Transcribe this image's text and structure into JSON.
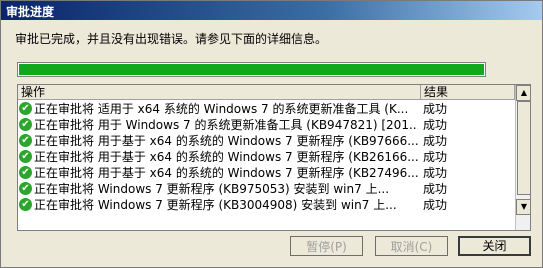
{
  "window": {
    "title": "审批进度"
  },
  "description": "审批已完成，并且没有出现错误。请参见下面的详细信息。",
  "progress": {
    "fraction": 1.0,
    "color": "#11a81d"
  },
  "table": {
    "columns": [
      "操作",
      "结果"
    ],
    "rows": [
      {
        "operation": "正在审批将 适用于 x64 系统的 Windows 7 的系统更新准备工具 (K...",
        "result": "成功"
      },
      {
        "operation": "正在审批将 用于 Windows 7 的系统更新准备工具 (KB947821) [201...",
        "result": "成功"
      },
      {
        "operation": "正在审批将 用于基于 x64 的系统的 Windows 7 更新程序 (KB97666...",
        "result": "成功"
      },
      {
        "operation": "正在审批将 用于基于 x64 的系统的 Windows 7 更新程序 (KB26166...",
        "result": "成功"
      },
      {
        "operation": "正在审批将 用于基于 x64 的系统的 Windows 7 更新程序 (KB27496...",
        "result": "成功"
      },
      {
        "operation": "正在审批将 Windows 7 更新程序 (KB975053) 安装到 win7 上...",
        "result": "成功"
      },
      {
        "operation": "正在审批将 Windows 7 更新程序 (KB3004908) 安装到 win7 上...",
        "result": "成功"
      }
    ]
  },
  "buttons": {
    "pause": "暂停(P)",
    "cancel": "取消(C)",
    "close": "关闭"
  },
  "icons": {
    "row_status": "check-circle-icon",
    "scroll_up": "scroll-up-icon",
    "scroll_down": "scroll-down-icon"
  }
}
